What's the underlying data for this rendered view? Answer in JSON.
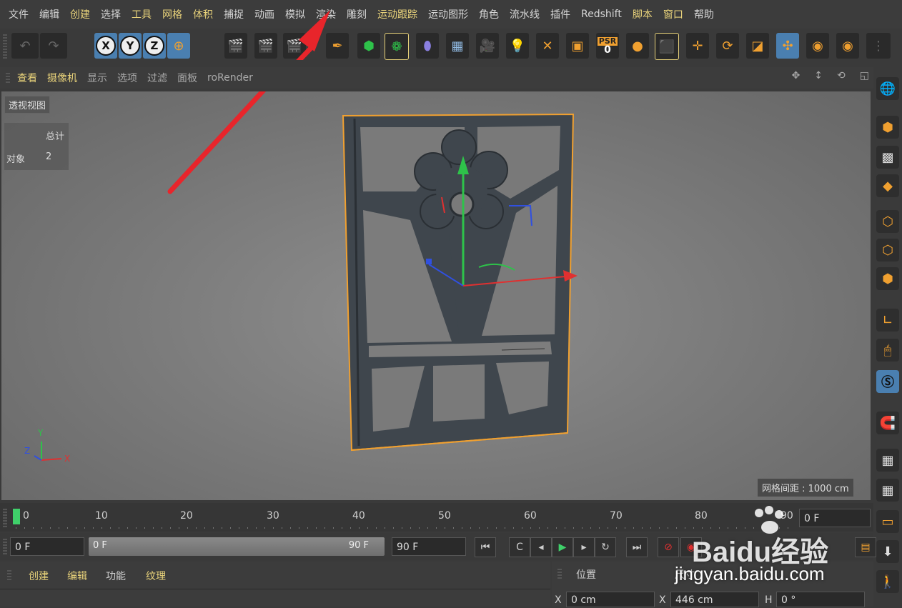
{
  "menubar": [
    "文件",
    "编辑",
    "创建",
    "选择",
    "工具",
    "网格",
    "体积",
    "捕捉",
    "动画",
    "模拟",
    "渲染",
    "雕刻",
    "运动跟踪",
    "运动图形",
    "角色",
    "流水线",
    "插件",
    "Redshift",
    "脚本",
    "窗口",
    "帮助"
  ],
  "viewport_menu": [
    "查看",
    "摄像机",
    "显示",
    "选项",
    "过滤",
    "面板",
    "roRender"
  ],
  "viewport": {
    "label": "透视视图",
    "hud_header": "总计",
    "hud_row_label": "对象",
    "hud_row_value": "2",
    "grid_spacing": "网格间距 : 1000 cm",
    "axis_labels": {
      "y": "Y",
      "z": "Z",
      "x": "X"
    }
  },
  "toolbar": {
    "axis_buttons": [
      "X",
      "Y",
      "Z"
    ],
    "psr_label": "PSR",
    "psr_value": "0"
  },
  "timeline": {
    "ticks": [
      "0",
      "10",
      "20",
      "30",
      "40",
      "50",
      "60",
      "70",
      "80",
      "90"
    ],
    "current_frame": "0 F"
  },
  "playbar": {
    "start_field": "0 F",
    "range_start": "0 F",
    "range_end": "90 F",
    "end_field": "90 F"
  },
  "bottom_left_tabs": [
    "创建",
    "编辑",
    "功能",
    "纹理"
  ],
  "bottom_right": {
    "tab_position": "位置",
    "tab_size": "尺寸",
    "x_label": "X",
    "x_value": "0 cm",
    "sx_label": "X",
    "sx_value": "446 cm",
    "h_label": "H",
    "h_value": "0 °"
  },
  "watermark": {
    "brand": "Baidu经验",
    "url": "jingyan.baidu.com"
  },
  "colors": {
    "accent": "#f0a030",
    "highlight_text": "#e8d27a",
    "arrow": "#e8252b",
    "y_axis": "#2ec24a",
    "x_axis": "#e03030",
    "z_axis": "#3050e0"
  }
}
